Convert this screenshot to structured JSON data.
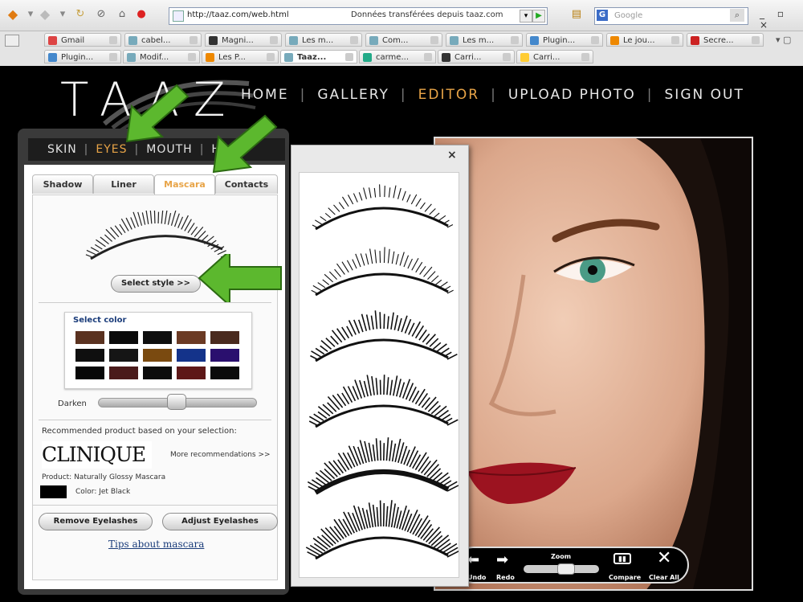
{
  "browser": {
    "url": "http://taaz.com/web.html",
    "status": "Données transférées depuis taaz.com",
    "search_placeholder": "Google",
    "tabs_row1": [
      {
        "label": "Gmail",
        "color": "#d44"
      },
      {
        "label": "cabel...",
        "color": "#7ab"
      },
      {
        "label": "Magni...",
        "color": "#333"
      },
      {
        "label": "Les m...",
        "color": "#7ab"
      },
      {
        "label": "Com...",
        "color": "#7ab"
      },
      {
        "label": "Les m...",
        "color": "#7ab"
      },
      {
        "label": "Plugin...",
        "color": "#48c"
      },
      {
        "label": "Le jou...",
        "color": "#e80"
      },
      {
        "label": "Secre...",
        "color": "#c22"
      }
    ],
    "tabs_row2": [
      {
        "label": "Plugin...",
        "color": "#48c"
      },
      {
        "label": "Modif...",
        "color": "#7ab"
      },
      {
        "label": "Les P...",
        "color": "#e80"
      },
      {
        "label": "Taaz...",
        "color": "#7ab"
      },
      {
        "label": "carme...",
        "color": "#2a8"
      },
      {
        "label": "Carri...",
        "color": "#333"
      },
      {
        "label": "Carri...",
        "color": "#fc3"
      }
    ]
  },
  "site": {
    "logo": "TAAZ",
    "nav": [
      "HOME",
      "GALLERY",
      "EDITOR",
      "UPLOAD PHOTO",
      "SIGN OUT"
    ],
    "nav_active": "EDITOR"
  },
  "editor": {
    "subnav": [
      "SKIN",
      "EYES",
      "MOUTH",
      "HAIR"
    ],
    "subnav_active": "EYES",
    "tabs": [
      "Shadow",
      "Liner",
      "Mascara",
      "Contacts"
    ],
    "tab_active": "Mascara",
    "select_style_label": "Select style >>",
    "select_color_title": "Select color",
    "swatches": [
      "#5a3220",
      "#0a0a0a",
      "#0e0e0e",
      "#6b3a24",
      "#4a2a1e",
      "#0f0f0f",
      "#151515",
      "#7a4a10",
      "#14338a",
      "#2a0f6e",
      "#080808",
      "#4a1a1a",
      "#0c0c0c",
      "#5e1818",
      "#0b0b0b"
    ],
    "darken_label": "Darken",
    "recommended_text": "Recommended product based on your selection:",
    "brand": "CLINIQUE",
    "more_link": "More recommendations >>",
    "product_text": "Product: Naturally Glossy Mascara",
    "color_text": "Color: Jet Black",
    "remove_button": "Remove Eyelashes",
    "adjust_button": "Adjust Eyelashes",
    "tips_link": "Tips about mascara"
  },
  "picker": {
    "close": "×"
  },
  "photo_toolbar": {
    "undo": "Undo",
    "redo": "Redo",
    "zoom": "Zoom",
    "compare": "Compare",
    "clear": "Clear All"
  }
}
